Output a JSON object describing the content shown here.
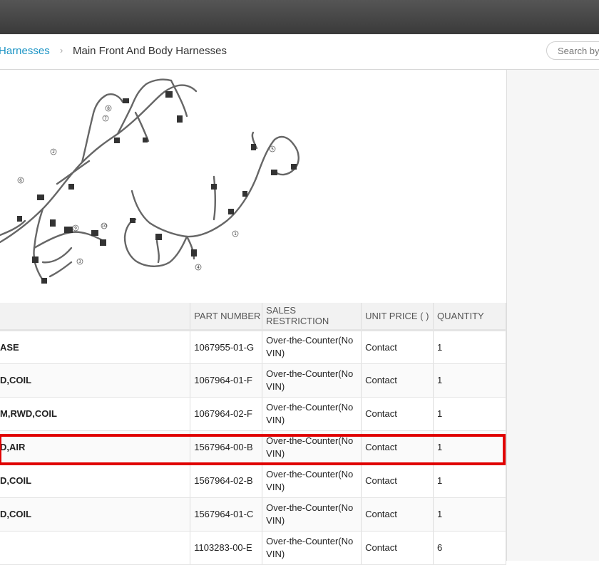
{
  "breadcrumb": {
    "parent": "Harnesses",
    "separator": "›",
    "current": "Main Front And Body Harnesses"
  },
  "search": {
    "placeholder": "Search by"
  },
  "diagram": {
    "callouts": [
      "1",
      "2",
      "3",
      "4",
      "5",
      "6",
      "7",
      "8",
      "9",
      "10"
    ]
  },
  "table": {
    "headers": [
      "",
      "PART NUMBER",
      "SALES RESTRICTION",
      "UNIT PRICE ( )",
      "QUANTITY"
    ],
    "rows": [
      {
        "name": "ASE",
        "part_number": "1067955-01-G",
        "restriction": "Over-the-Counter(No VIN)",
        "price": "Contact",
        "qty": "1"
      },
      {
        "name": "D,COIL",
        "part_number": "1067964-01-F",
        "restriction": "Over-the-Counter(No VIN)",
        "price": "Contact",
        "qty": "1"
      },
      {
        "name": "M,RWD,COIL",
        "part_number": "1067964-02-F",
        "restriction": "Over-the-Counter(No VIN)",
        "price": "Contact",
        "qty": "1"
      },
      {
        "name": "D,AIR",
        "part_number": "1567964-00-B",
        "restriction": "Over-the-Counter(No VIN)",
        "price": "Contact",
        "qty": "1"
      },
      {
        "name": "D,COIL",
        "part_number": "1567964-02-B",
        "restriction": "Over-the-Counter(No VIN)",
        "price": "Contact",
        "qty": "1"
      },
      {
        "name": "D,COIL",
        "part_number": "1567964-01-C",
        "restriction": "Over-the-Counter(No VIN)",
        "price": "Contact",
        "qty": "1"
      },
      {
        "name": "",
        "part_number": "1103283-00-E",
        "restriction": "Over-the-Counter(No VIN)",
        "price": "Contact",
        "qty": "6"
      }
    ]
  },
  "colors": {
    "accent": "#1a93c4",
    "highlight": "#e00000",
    "topbar": "#444444"
  }
}
